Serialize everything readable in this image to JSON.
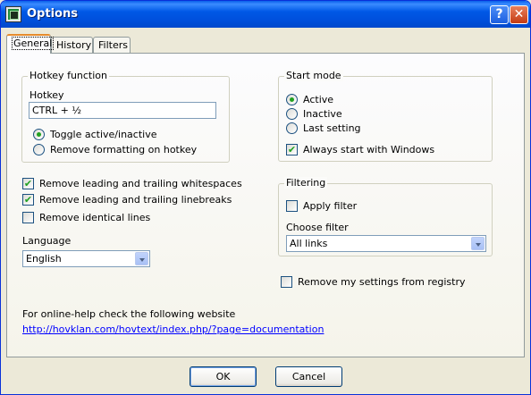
{
  "window": {
    "title": "Options",
    "help_label": "?",
    "close_label": "✕"
  },
  "tabs": [
    {
      "label": "General",
      "active": true
    },
    {
      "label": "History",
      "active": false
    },
    {
      "label": "Filters",
      "active": false
    }
  ],
  "hotkey_group": {
    "title": "Hotkey function",
    "hotkey_label": "Hotkey",
    "hotkey_value": "CTRL + ½",
    "options": [
      {
        "label": "Toggle active/inactive",
        "selected": true
      },
      {
        "label": "Remove formatting on hotkey",
        "selected": false
      }
    ]
  },
  "start_mode_group": {
    "title": "Start mode",
    "options": [
      {
        "label": "Active",
        "selected": true
      },
      {
        "label": "Inactive",
        "selected": false
      },
      {
        "label": "Last setting",
        "selected": false
      }
    ],
    "always_start": {
      "label": "Always start with Windows",
      "checked": true
    }
  },
  "text_options": [
    {
      "label": "Remove leading and trailing whitespaces",
      "checked": true
    },
    {
      "label": "Remove leading and trailing linebreaks",
      "checked": true
    },
    {
      "label": "Remove identical lines",
      "checked": false
    }
  ],
  "language": {
    "label": "Language",
    "value": "English"
  },
  "filtering_group": {
    "title": "Filtering",
    "apply_filter": {
      "label": "Apply filter",
      "checked": false
    },
    "choose_filter_label": "Choose filter",
    "filter_value": "All links"
  },
  "remove_registry": {
    "label": "Remove my settings from registry",
    "checked": false
  },
  "help": {
    "text": "For online-help check the following website",
    "url": "http://hovklan.com/hovtext/index.php/?page=documentation"
  },
  "buttons": {
    "ok": "OK",
    "cancel": "Cancel"
  }
}
